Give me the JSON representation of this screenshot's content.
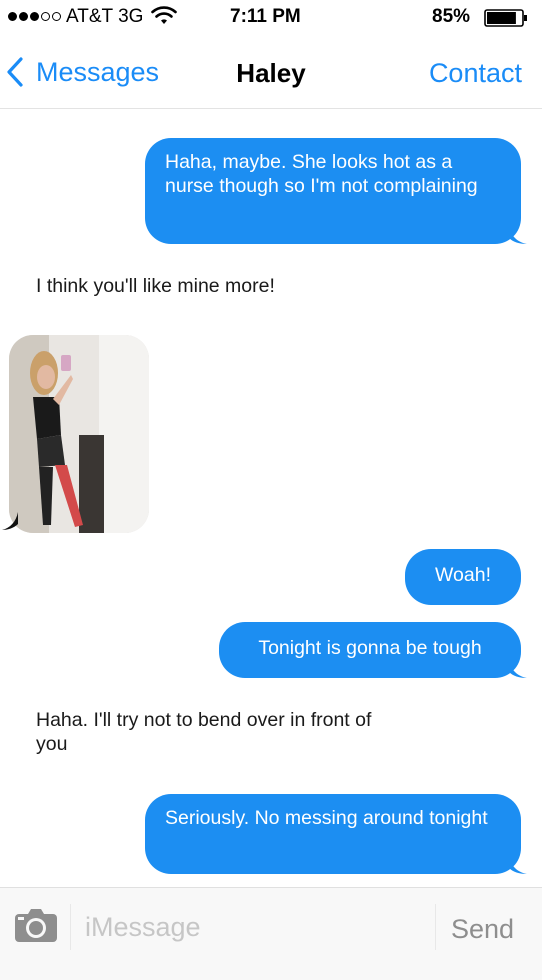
{
  "status_bar": {
    "carrier": "AT&T 3G",
    "time": "7:11 PM",
    "battery": "85%",
    "battery_level": 0.85,
    "signal_bars": 3,
    "signal_total": 5
  },
  "nav": {
    "back_label": "Messages",
    "title": "Haley",
    "contact_label": "Contact"
  },
  "messages": [
    {
      "from": "me",
      "text": "Haha, maybe. She looks hot as a nurse though so I'm not complaining"
    },
    {
      "from": "them",
      "text": "I think you'll like mine more!"
    },
    {
      "from": "them",
      "type": "photo"
    },
    {
      "from": "me",
      "text": "Woah!"
    },
    {
      "from": "me",
      "text": "Tonight is gonna be tough"
    },
    {
      "from": "them",
      "text": "Haha. I'll try not to bend over in front of you"
    },
    {
      "from": "me",
      "text": "Seriously. No messing around tonight"
    }
  ],
  "input": {
    "placeholder": "iMessage",
    "send_label": "Send"
  },
  "colors": {
    "accent": "#1a8cf7",
    "sent_bubble": "#1c8ef2",
    "placeholder": "#c6c6c6",
    "send_disabled": "#8e8e8e"
  },
  "icons": {
    "wifi": "wifi-icon",
    "battery": "battery-icon",
    "back": "chevron-left-icon",
    "camera": "camera-icon"
  }
}
